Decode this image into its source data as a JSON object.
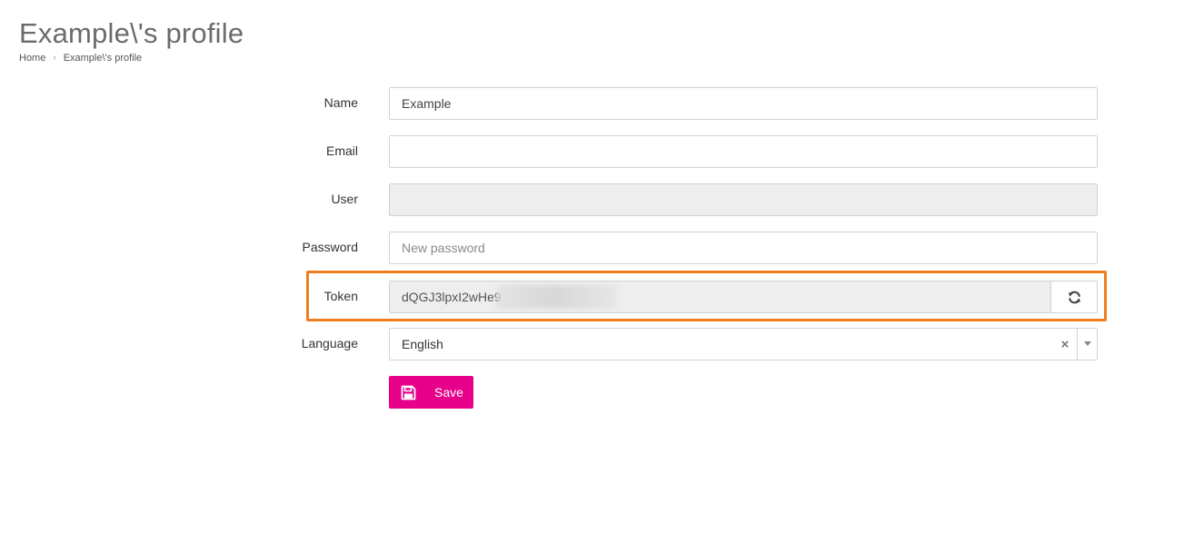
{
  "page": {
    "title": "Example\\'s profile"
  },
  "breadcrumb": {
    "home": "Home",
    "current": "Example\\'s profile",
    "separator": "›"
  },
  "form": {
    "name": {
      "label": "Name",
      "value": "Example",
      "placeholder": ""
    },
    "email": {
      "label": "Email",
      "value": "",
      "placeholder": ""
    },
    "user": {
      "label": "User",
      "value": ""
    },
    "password": {
      "label": "Password",
      "value": "",
      "placeholder": "New password"
    },
    "token": {
      "label": "Token",
      "value": "dQGJ3lpxI2wHe9"
    },
    "language": {
      "label": "Language",
      "value": "English",
      "clear": "×"
    },
    "save_label": "Save"
  },
  "icons": {
    "refresh": "refresh-icon",
    "save": "floppy-disk-icon",
    "clear": "close-icon",
    "dropdown": "caret-down-icon"
  },
  "colors": {
    "accent": "#e6008a",
    "highlight": "#f07d1e",
    "readonly_bg": "#eeeeee"
  }
}
